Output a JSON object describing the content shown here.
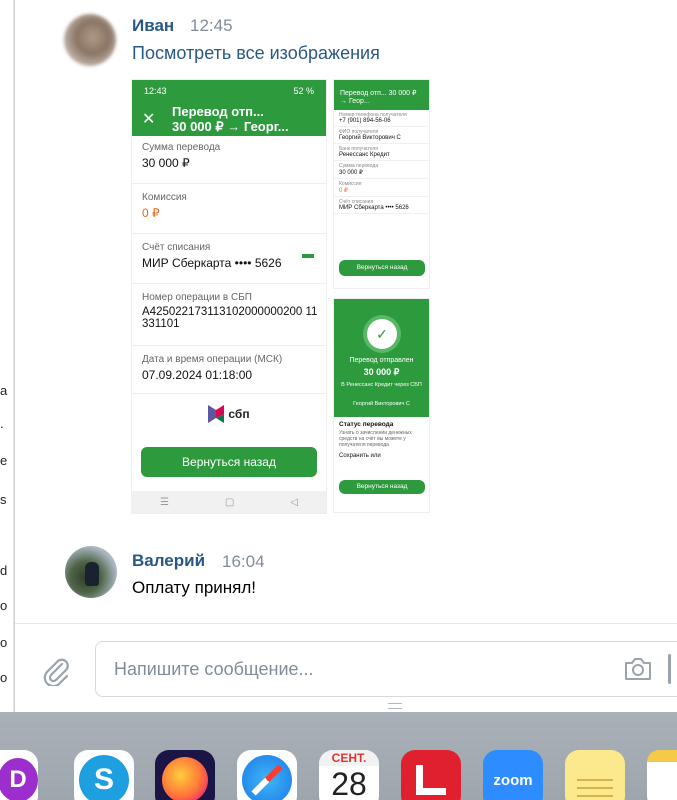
{
  "left_strip": [
    "а",
    ".",
    "е",
    "s",
    "d",
    "о",
    "о",
    "о"
  ],
  "messages": [
    {
      "author": "Иван",
      "time": "12:45",
      "link": "Посмотреть все изображения",
      "attachment": {
        "big": {
          "status_time": "12:43",
          "status_battery": "52 %",
          "header_line1": "Перевод отп...",
          "header_line2": "30 000 ₽ → Георг...",
          "fields": [
            {
              "label": "Сумма перевода",
              "value": "30 000 ₽"
            },
            {
              "label": "Комиссия",
              "value": "0 ₽"
            },
            {
              "label": "Счёт списания",
              "value": "МИР Сберкарта •••• 5626"
            },
            {
              "label": "Номер операции в СБП",
              "value": "A425022173113102000000200 11331101"
            },
            {
              "label": "Дата и время операции (МСК)",
              "value": "07.09.2024 01:18:00"
            }
          ],
          "sbp_label": "сбп",
          "button": "Вернуться назад"
        },
        "small1": {
          "header": "Перевод отп... 30 000 ₽ → Геор...",
          "fields": [
            {
              "label": "Номер телефона получателя",
              "value": "+7 (901) 894-56-06"
            },
            {
              "label": "ФИО получателя",
              "value": "Георгий Викторович С"
            },
            {
              "label": "Банк получателя",
              "value": "Ренессанс Кредит"
            },
            {
              "label": "Сумма перевода",
              "value": "30 000 ₽"
            },
            {
              "label": "Комиссия",
              "value": "0 ₽"
            },
            {
              "label": "Счёт списания",
              "value": "МИР Сберкарта •••• 5626"
            }
          ],
          "button": "Вернуться назад"
        },
        "small2": {
          "title": "Перевод отправлен",
          "amount": "30 000 ₽",
          "line1": "В Ренессанс Кредит через СБП",
          "line2": "Георгий Викторович С",
          "status_title": "Статус перевода",
          "status_text": "Узнать о зачислении денежных средств на счёт вы можете у получателя перевода",
          "save_label": "Сохранить или",
          "button": "Вернуться назад"
        }
      }
    },
    {
      "author": "Валерий",
      "time": "16:04",
      "text": "Оплату принял!"
    }
  ],
  "composer": {
    "placeholder": "Напишите сообщение..."
  },
  "dock": {
    "calendar_month": "СЕНТ.",
    "calendar_day": "28",
    "zoom_label": "zoom"
  }
}
